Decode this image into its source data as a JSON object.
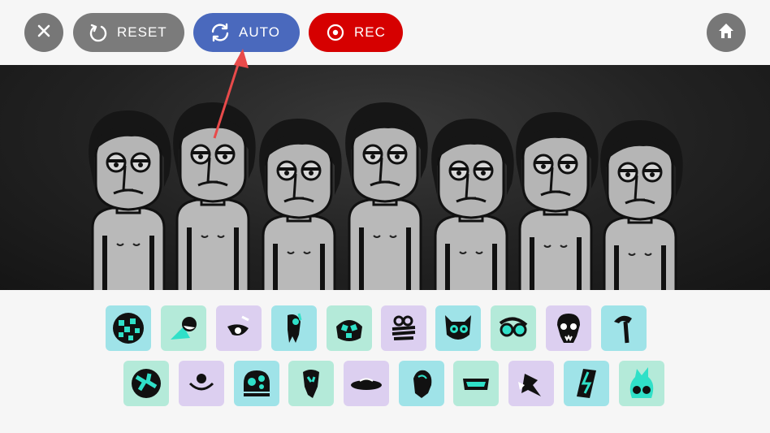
{
  "toolbar": {
    "close_icon": "close-icon",
    "reset_label": "RESET",
    "auto_label": "AUTO",
    "rec_label": "REC",
    "home_icon": "home-icon",
    "colors": {
      "neutral": "#777777",
      "auto": "#4a69bd",
      "rec": "#d60000"
    }
  },
  "stage": {
    "characters": [
      "character-1",
      "character-2",
      "character-3",
      "character-4",
      "character-5",
      "character-6",
      "character-7"
    ]
  },
  "sound_tray": {
    "row1": [
      "icon-1",
      "icon-2",
      "icon-3",
      "icon-4",
      "icon-5",
      "icon-6",
      "icon-7",
      "icon-8",
      "icon-9",
      "icon-10"
    ],
    "row2": [
      "icon-11",
      "icon-12",
      "icon-13",
      "icon-14",
      "icon-15",
      "icon-16",
      "icon-17",
      "icon-18",
      "icon-19",
      "icon-20"
    ],
    "tile_colors": {
      "teal": "#9fe3e8",
      "mint": "#b4ead9",
      "lilac": "#dccff0"
    }
  },
  "annotation": {
    "pointer": "red-arrow-pointing-at-auto"
  }
}
